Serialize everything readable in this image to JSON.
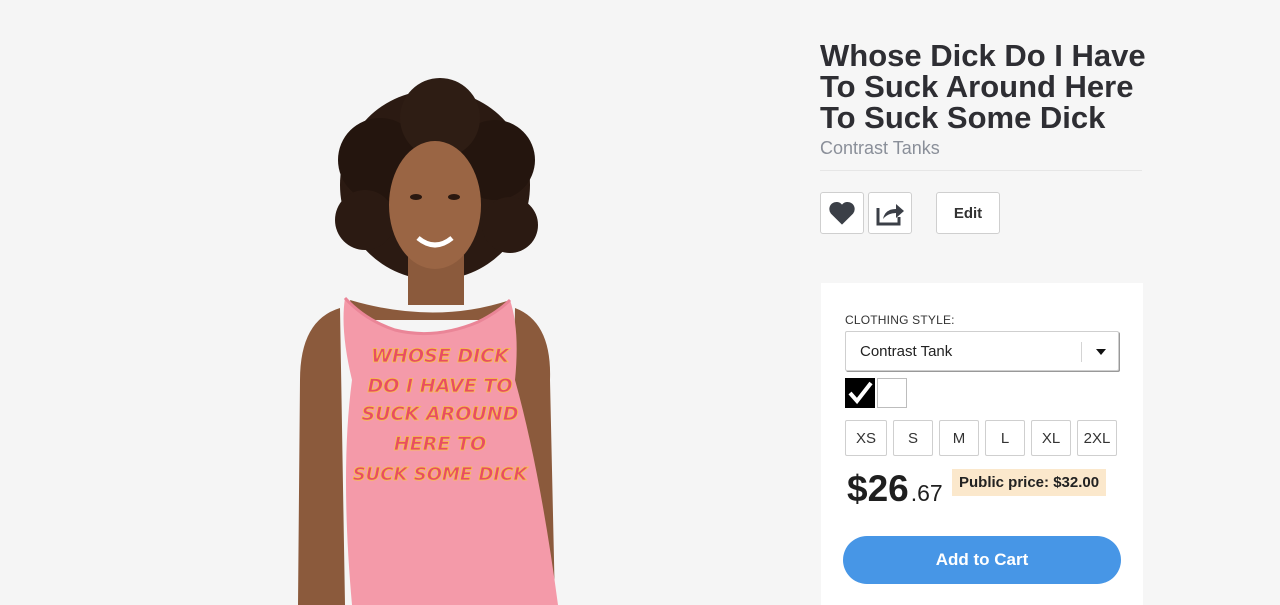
{
  "product": {
    "title": "Whose Dick Do I Have To Suck Around Here To Suck Some Dick",
    "subtitle": "Contrast Tanks",
    "shirt_lines": [
      "WHOSE DICK",
      "DO I HAVE TO",
      "SUCK AROUND",
      "HERE TO",
      "SUCK SOME DICK"
    ]
  },
  "actions": {
    "favorite_icon": "heart-icon",
    "share_icon": "share-icon",
    "edit_label": "Edit"
  },
  "options": {
    "style_label": "CLOTHING STYLE:",
    "style_value": "Contrast Tank",
    "colors": [
      {
        "name": "black",
        "hex": "#000000",
        "selected": true
      },
      {
        "name": "white",
        "hex": "#ffffff",
        "selected": false
      }
    ],
    "sizes": [
      "XS",
      "S",
      "M",
      "L",
      "XL",
      "2XL"
    ]
  },
  "pricing": {
    "price_main": "$26",
    "price_cents": ".67",
    "public_price": "Public price: $32.00"
  },
  "cart": {
    "label": "Add to Cart"
  },
  "colors": {
    "accent": "#4796e6",
    "shirt": "#f49aa9",
    "public_price_bg": "#fbe8cc"
  }
}
